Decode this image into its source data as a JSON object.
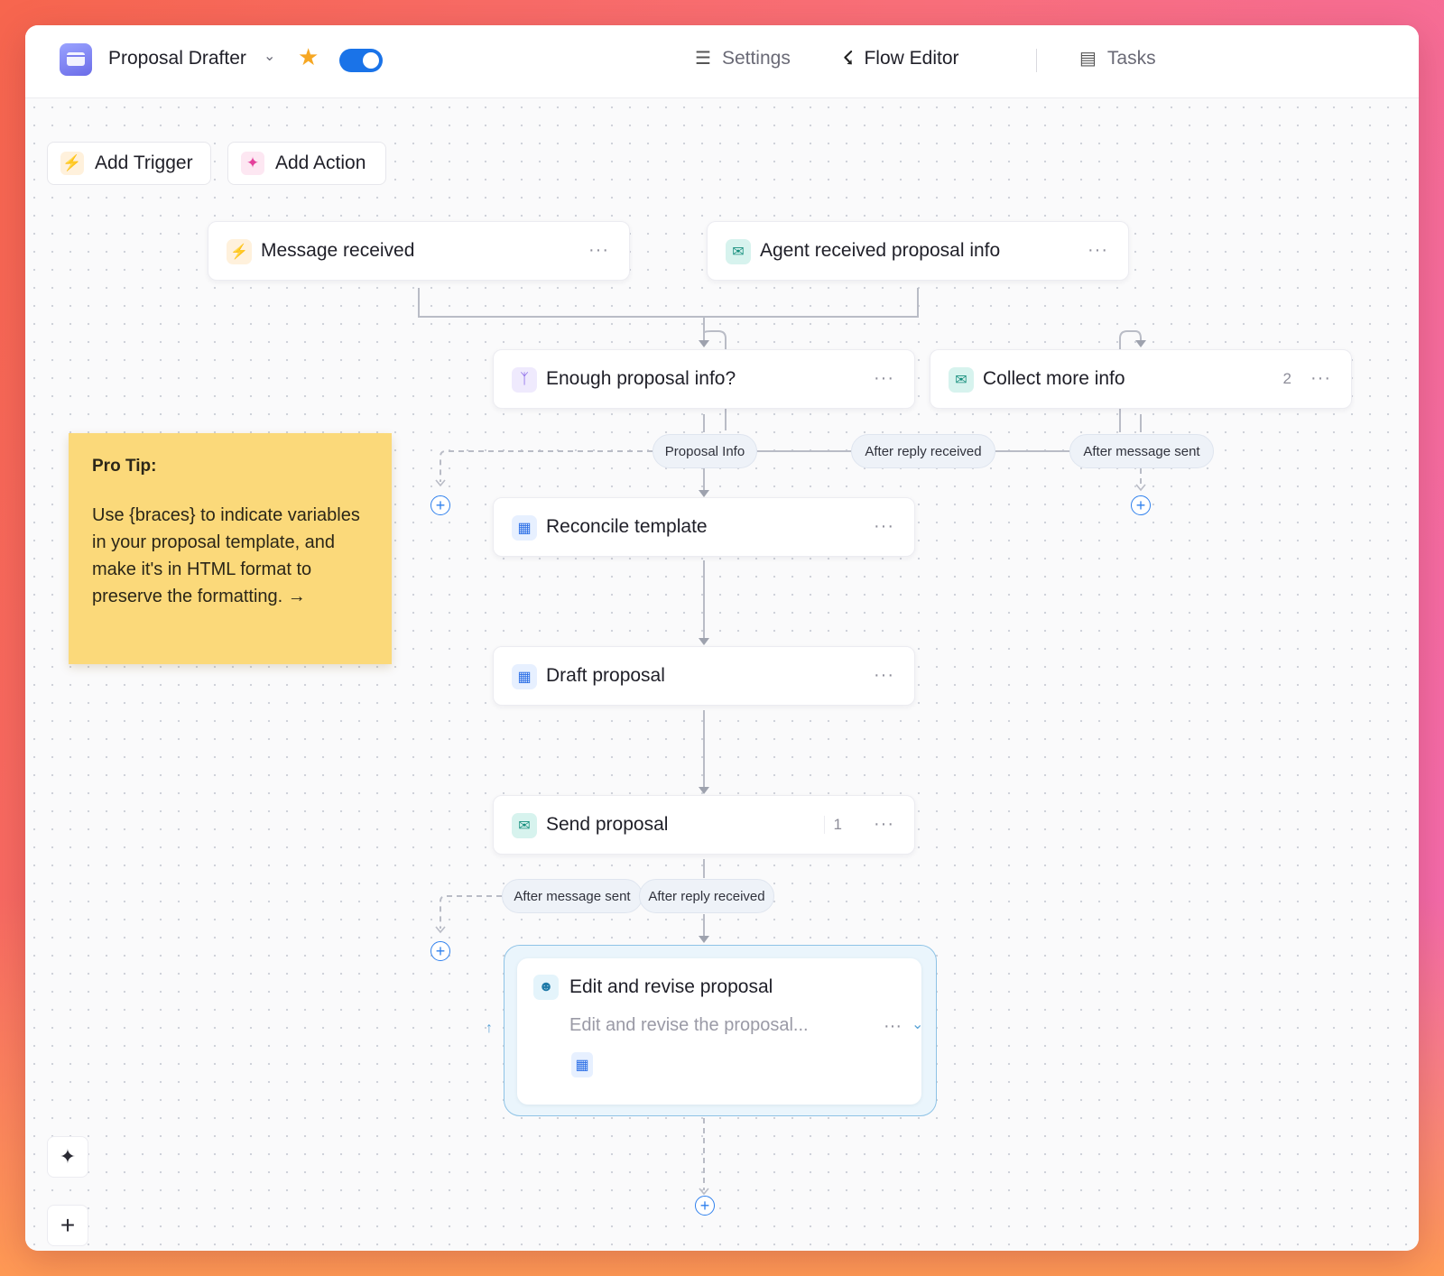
{
  "app": {
    "title": "Proposal Drafter"
  },
  "nav": {
    "settings": "Settings",
    "flow_editor": "Flow Editor",
    "tasks": "Tasks"
  },
  "toolbar": {
    "add_trigger": "Add Trigger",
    "add_action": "Add Action"
  },
  "nodes": {
    "message_received": {
      "title": "Message received"
    },
    "agent_received": {
      "title": "Agent received proposal info"
    },
    "enough_info": {
      "title": "Enough proposal info?"
    },
    "collect_more": {
      "title": "Collect more info",
      "count": "2"
    },
    "reconcile": {
      "title": "Reconcile template"
    },
    "draft": {
      "title": "Draft proposal"
    },
    "send": {
      "title": "Send proposal",
      "count": "1"
    },
    "edit": {
      "title": "Edit and revise proposal",
      "subtitle": "Edit and revise the proposal..."
    }
  },
  "branches": {
    "proposal_info": "Proposal Info",
    "after_reply_1": "After reply received",
    "after_message_1": "After message sent",
    "after_message_2": "After message sent",
    "after_reply_2": "After reply received"
  },
  "tip": {
    "title": "Pro Tip:",
    "body": "Use {braces} to indicate variables in your proposal template, and make it's in HTML format to preserve the formatting. →"
  },
  "icons": {
    "app": "app-window-icon",
    "star": "star-icon",
    "settings": "sliders-icon",
    "flow": "flow-icon",
    "tasks": "clipboard-icon",
    "trigger": "bolt-icon",
    "action": "sparkle-icon",
    "dots": "more-icon",
    "plus": "plus-circle-icon"
  },
  "colors": {
    "accent": "#1a73e8",
    "star": "#f6a723",
    "sticky": "#fbd97a"
  }
}
